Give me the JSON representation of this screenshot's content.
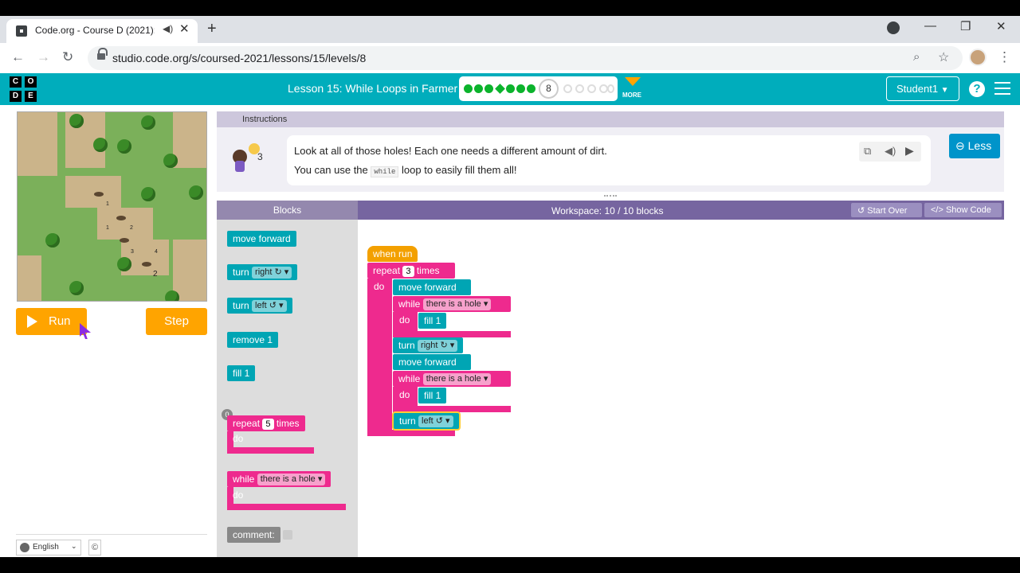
{
  "browser": {
    "tab_title": "Code.org - Course D (2021):",
    "url": "studio.code.org/s/coursed-2021/lessons/15/levels/8"
  },
  "header": {
    "logo_letters": [
      "C",
      "O",
      "D",
      "E"
    ],
    "lesson_title": "Lesson 15: While Loops in Farmer",
    "current_level": "8",
    "more_label": "MORE",
    "user_label": "Student1",
    "help_label": "?"
  },
  "visualization": {
    "hole_counts": [
      "1",
      "1",
      "2",
      "3",
      "4",
      "2"
    ]
  },
  "controls": {
    "run_label": "Run",
    "step_label": "Step"
  },
  "instructions": {
    "tab_label": "Instructions",
    "hint_count": "3",
    "line1": "Look at all of those holes! Each one needs a different amount of dirt.",
    "line2_before": "You can use the",
    "line2_code": "while",
    "line2_after": "loop to easily fill them all!",
    "less_label": "Less"
  },
  "blocks_header": "Blocks",
  "workspace": {
    "title": "Workspace: 10 / 10 blocks",
    "start_over": "Start Over",
    "show_code": "Show Code"
  },
  "toolbox": {
    "move_forward": "move forward",
    "turn": "turn",
    "right": "right ↻",
    "left": "left ↺",
    "remove": "remove 1",
    "fill": "fill 1",
    "repeat": "repeat",
    "repeat_count": "5",
    "times": "times",
    "do": "do",
    "while": "while",
    "condition": "there is a hole",
    "comment": "comment:",
    "limit_badge": "0"
  },
  "program": {
    "when_run": "when run",
    "repeat": "repeat",
    "repeat_count": "3",
    "times": "times",
    "do": "do",
    "move_forward": "move forward",
    "while": "while",
    "condition": "there is a hole",
    "fill": "fill 1",
    "turn": "turn",
    "right": "right ↻",
    "left": "left ↺"
  },
  "footer": {
    "language": "English",
    "copyright": "©"
  }
}
